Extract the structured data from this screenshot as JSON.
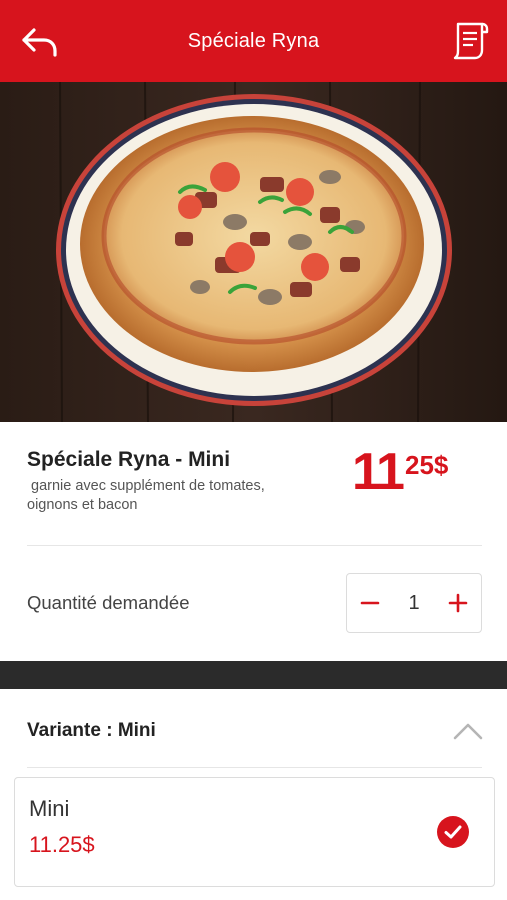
{
  "header": {
    "title": "Spéciale Ryna",
    "back_icon": "back-arrow-icon",
    "receipt_icon": "receipt-icon",
    "color": "#d7141d"
  },
  "product": {
    "name": "Spéciale Ryna - Mini",
    "description_line1": " garnie avec supplément de tomates,",
    "description_line2": "oignons et bacon",
    "image": "pizza-photo",
    "price": {
      "integer": "11",
      "cents": "25",
      "currency": "$"
    }
  },
  "quantity": {
    "label": "Quantité demandée",
    "value": "1",
    "minus_icon": "minus-icon",
    "plus_icon": "plus-icon"
  },
  "variant": {
    "label": "Variante : Mini",
    "chevron_icon": "chevron-up-icon",
    "options": [
      {
        "name": "Mini",
        "price": "11.25$",
        "selected": true
      }
    ]
  },
  "colors": {
    "accent": "#d7141d",
    "dark_bar": "#2b2b2b"
  }
}
